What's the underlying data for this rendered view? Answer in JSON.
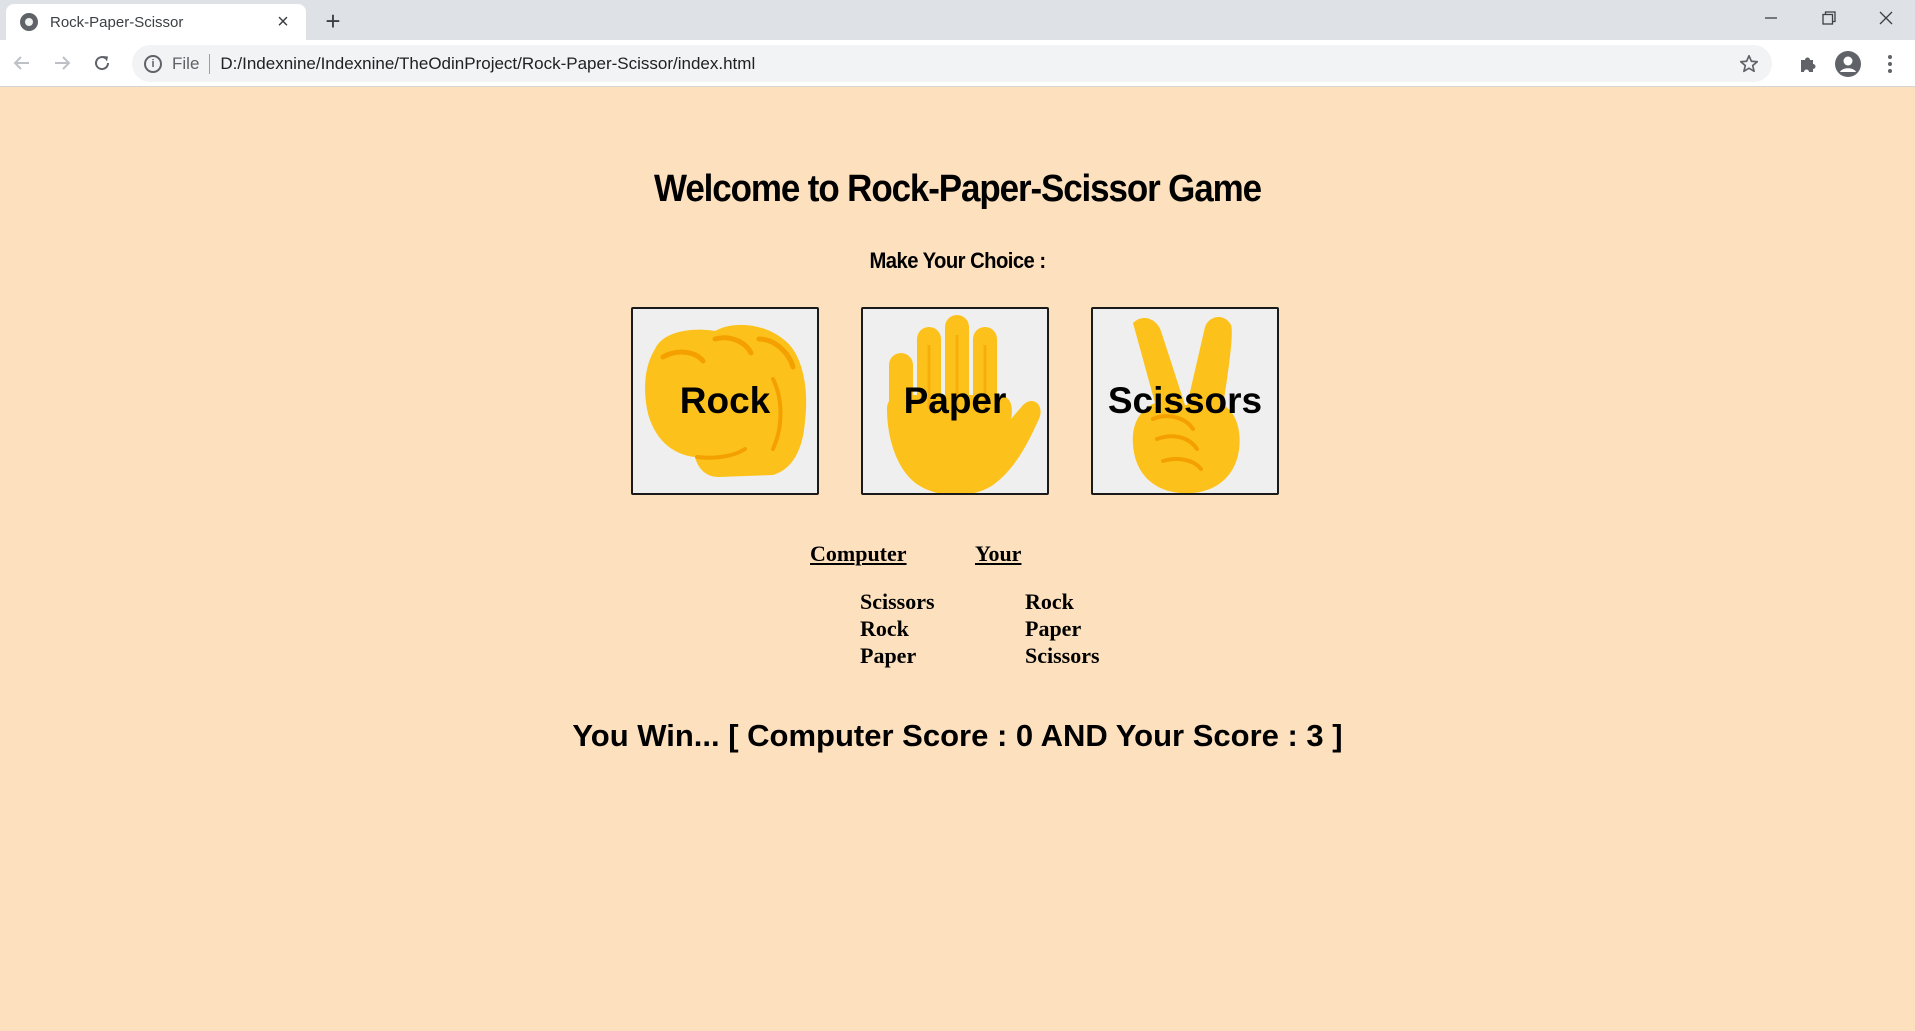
{
  "browser": {
    "tab_title": "Rock-Paper-Scissor",
    "scheme_label": "File",
    "url": "D:/Indexnine/Indexnine/TheOdinProject/Rock-Paper-Scissor/index.html",
    "icons": {
      "tab": "globe-icon",
      "close": "close-icon",
      "new_tab": "plus-icon",
      "back": "arrow-left-icon",
      "forward": "arrow-right-icon",
      "reload": "reload-icon",
      "info": "info-icon",
      "bookmark": "star-icon",
      "extensions": "puzzle-icon",
      "profile": "account-icon",
      "menu": "kebab-menu-icon",
      "minimize": "minimize-icon",
      "restore": "restore-icon",
      "window_close": "close-icon"
    }
  },
  "page": {
    "title": "Welcome to Rock-Paper-Scissor Game",
    "prompt": "Make Your Choice :",
    "choices": [
      {
        "label": "Rock",
        "icon": "fist-icon"
      },
      {
        "label": "Paper",
        "icon": "raised-hand-icon"
      },
      {
        "label": "Scissors",
        "icon": "victory-hand-icon"
      }
    ],
    "history": {
      "computer_header": "Computer",
      "your_header": "Your",
      "computer_moves": [
        "Scissors",
        "Rock",
        "Paper"
      ],
      "your_moves": [
        "Rock",
        "Paper",
        "Scissors"
      ]
    },
    "result": "You Win... [ Computer Score : 0 AND Your Score : 3 ]"
  },
  "colors": {
    "page_background": "#fde0bd",
    "button_background": "#efefef",
    "emoji_yellow": "#fcc21b",
    "emoji_shade": "#f4a000"
  }
}
